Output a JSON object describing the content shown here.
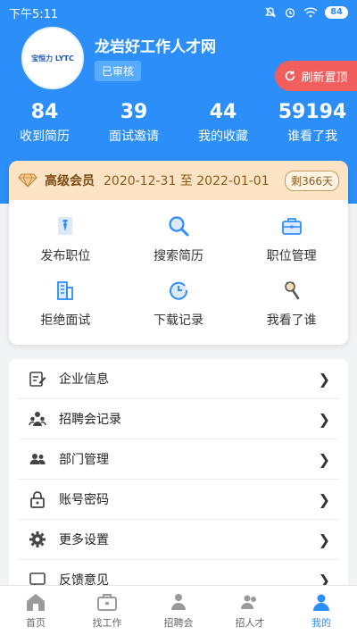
{
  "status_bar": {
    "time": "下午5:11",
    "battery": "84"
  },
  "header": {
    "avatar_logo_text_a": "宝恒力",
    "avatar_logo_text_b": "LYTC",
    "company_name": "龙岩好工作人才网",
    "verified_label": "已审核",
    "refresh_label": "刷新置顶"
  },
  "stats": [
    {
      "value": "84",
      "label": "收到简历"
    },
    {
      "value": "39",
      "label": "面试邀请"
    },
    {
      "value": "44",
      "label": "我的收藏"
    },
    {
      "value": "59194",
      "label": "谁看了我"
    }
  ],
  "vip": {
    "level": "高级会员",
    "dates": "2020-12-31 至 2022-01-01",
    "remaining": "剩366天"
  },
  "quick_actions": [
    {
      "label": "发布职位",
      "icon": "post-job-icon"
    },
    {
      "label": "搜索简历",
      "icon": "search-icon"
    },
    {
      "label": "职位管理",
      "icon": "briefcase-icon"
    },
    {
      "label": "拒绝面试",
      "icon": "building-icon"
    },
    {
      "label": "下载记录",
      "icon": "clock-icon"
    },
    {
      "label": "我看了谁",
      "icon": "viewed-icon"
    }
  ],
  "menu": [
    {
      "label": "企业信息",
      "icon": "company-info-icon"
    },
    {
      "label": "招聘会记录",
      "icon": "job-fair-icon"
    },
    {
      "label": "部门管理",
      "icon": "department-icon"
    },
    {
      "label": "账号密码",
      "icon": "lock-icon"
    },
    {
      "label": "更多设置",
      "icon": "gear-icon"
    },
    {
      "label": "反馈意见",
      "icon": "feedback-icon"
    }
  ],
  "tabbar": [
    {
      "label": "首页",
      "icon": "home-icon"
    },
    {
      "label": "找工作",
      "icon": "job-search-icon"
    },
    {
      "label": "招聘会",
      "icon": "job-fair-tab-icon"
    },
    {
      "label": "招人才",
      "icon": "talent-icon"
    },
    {
      "label": "我的",
      "icon": "profile-icon"
    }
  ],
  "colors": {
    "primary": "#2c8ef8",
    "refresh": "#f25d5d",
    "vip_bg": "#fbe3c4",
    "vip_text": "#7a4a12"
  }
}
